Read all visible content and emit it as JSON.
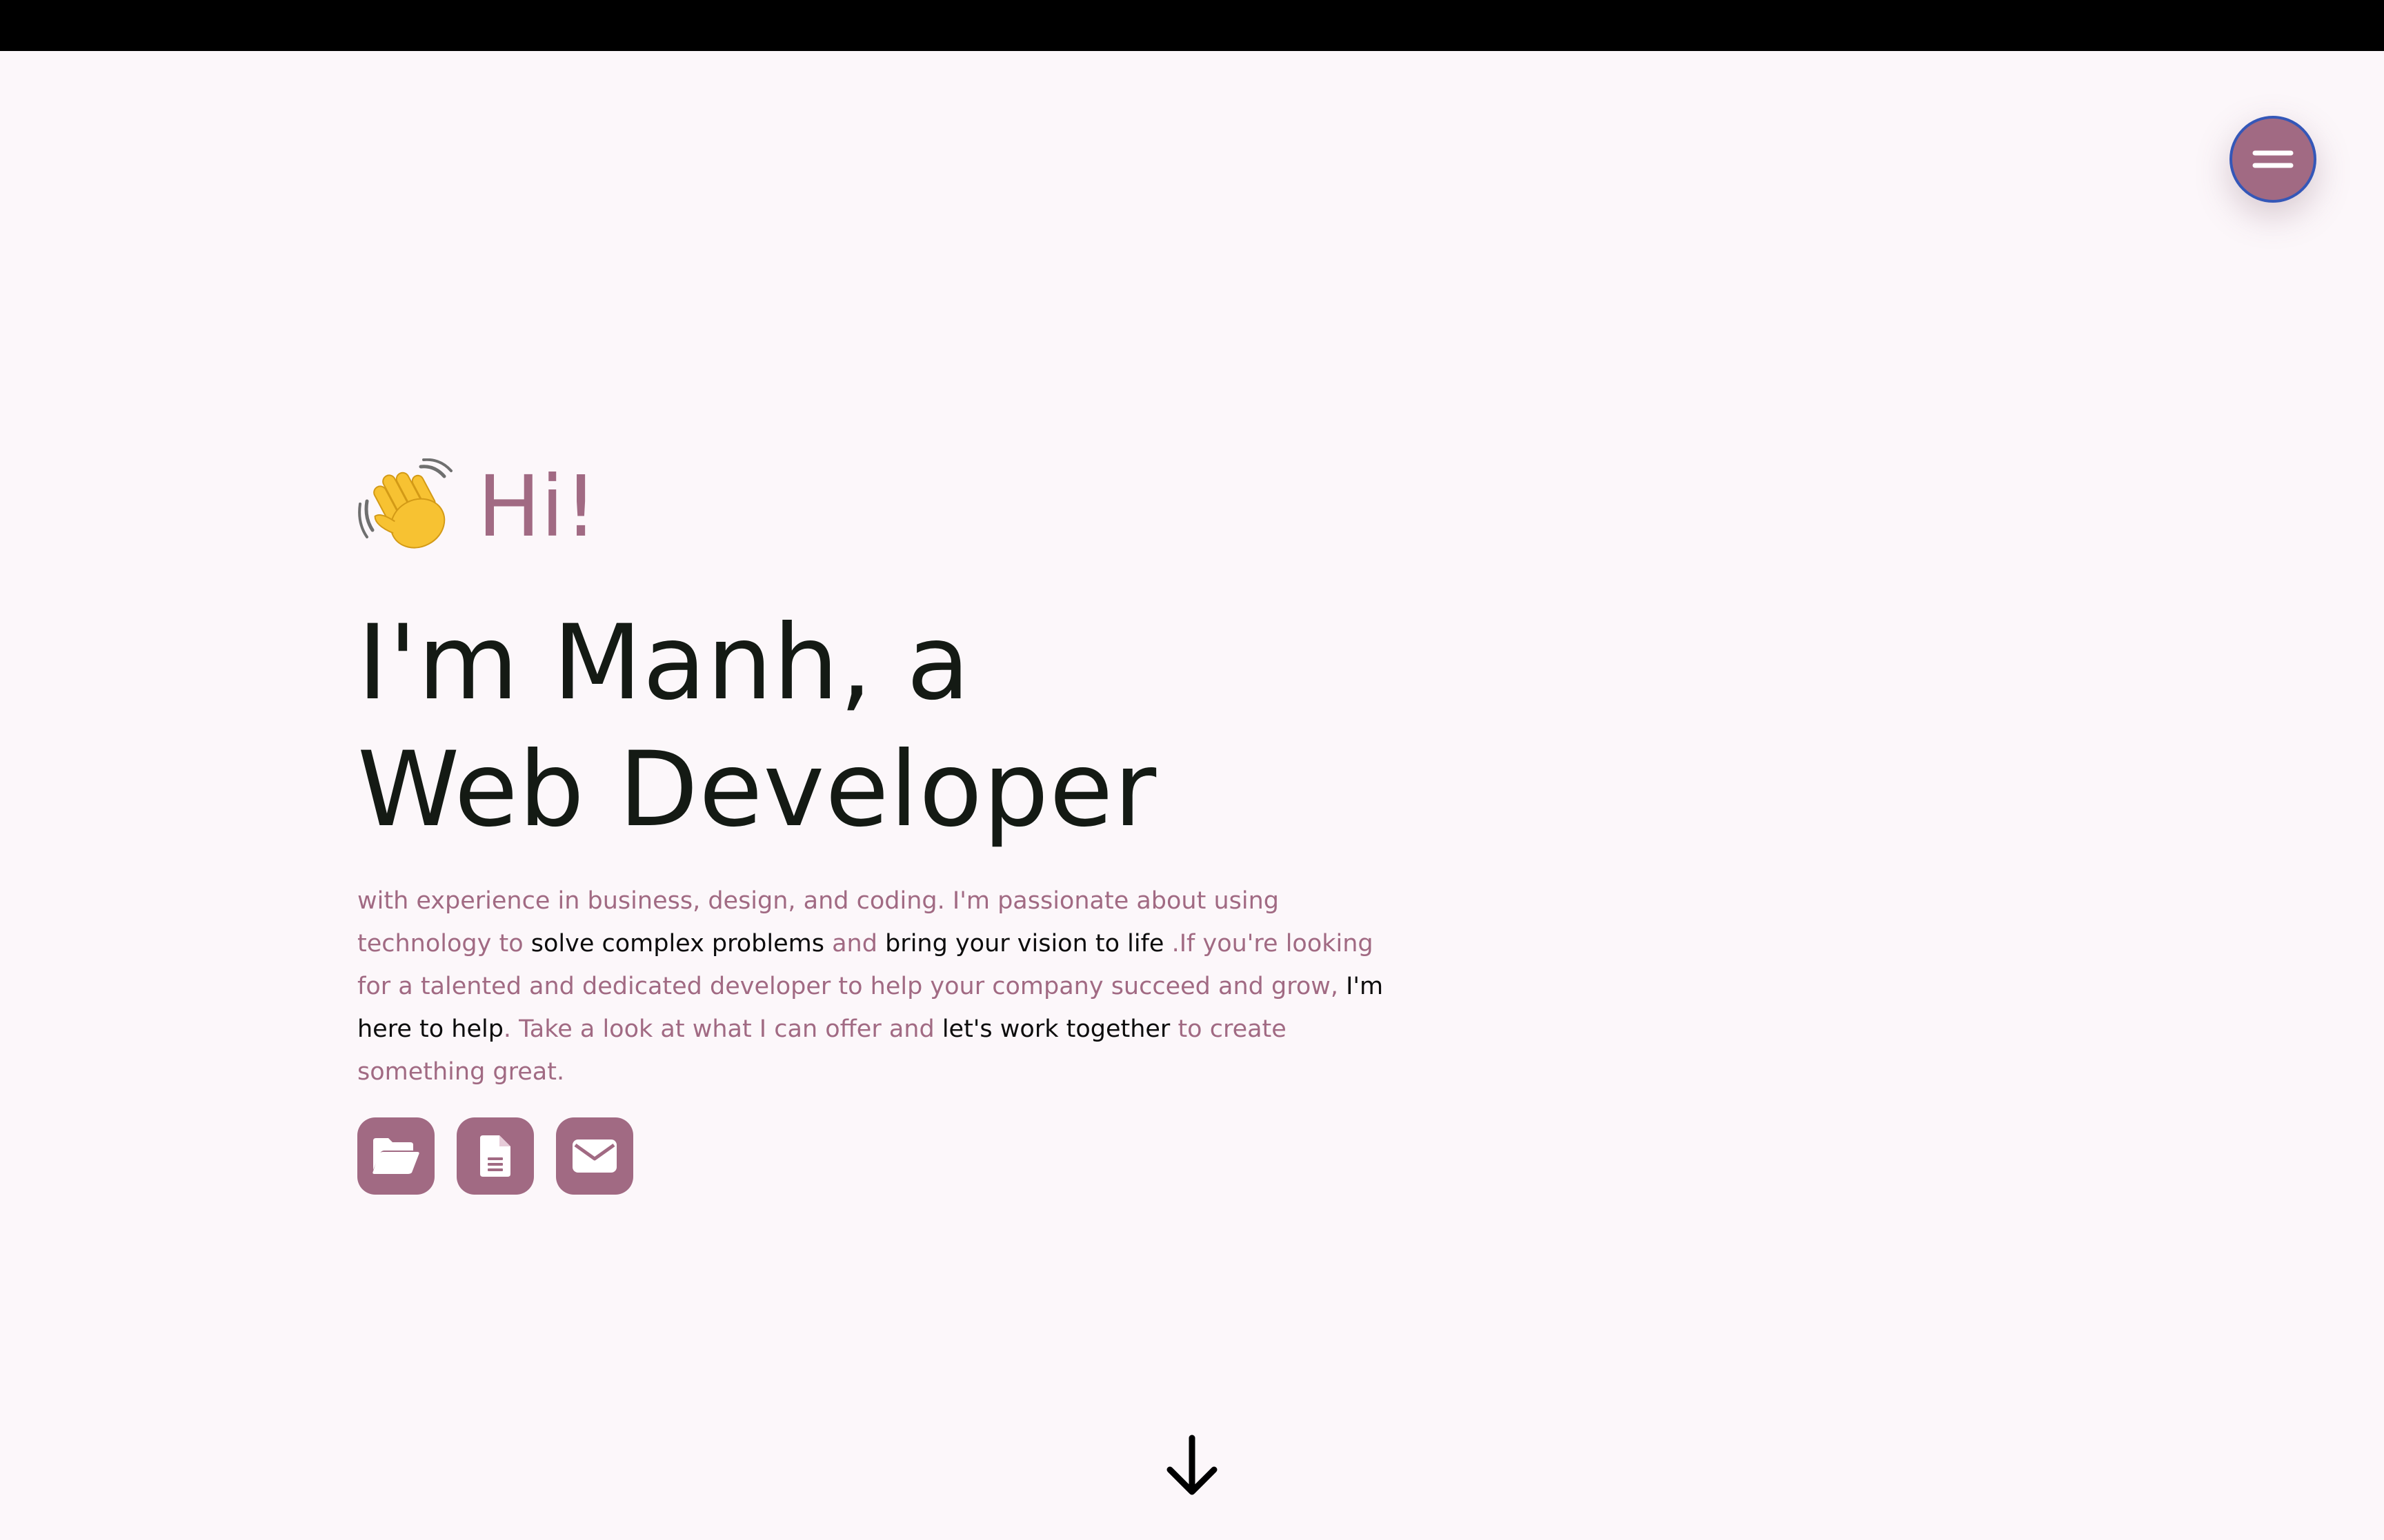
{
  "header": {
    "menu_icon": "hamburger-icon"
  },
  "hero": {
    "greeting_icon": "waving-hand-icon",
    "greeting": "Hi!",
    "headline_line1": "I'm Manh, a",
    "headline_line2": "Web Developer",
    "intro": {
      "p1": "with experience in business, design, and coding. I'm passionate about using technology to ",
      "em1": "solve complex problems",
      "p2": " and ",
      "em2": "bring your vision to life",
      "p3": " .If you're looking for a talented and dedicated developer to help your company succeed and grow, ",
      "em3": "I'm here to help",
      "p4": ". Take a look at what I can offer and ",
      "em4": "let's work together",
      "p5": " to create something great."
    },
    "actions": [
      {
        "icon": "folder-open-icon"
      },
      {
        "icon": "document-icon"
      },
      {
        "icon": "envelope-icon"
      }
    ]
  },
  "scroll": {
    "icon": "arrow-down-icon"
  },
  "colors": {
    "accent": "#a16a83",
    "background": "#fcf7fa",
    "heading": "#141a14",
    "menu_border": "#3457b8"
  }
}
